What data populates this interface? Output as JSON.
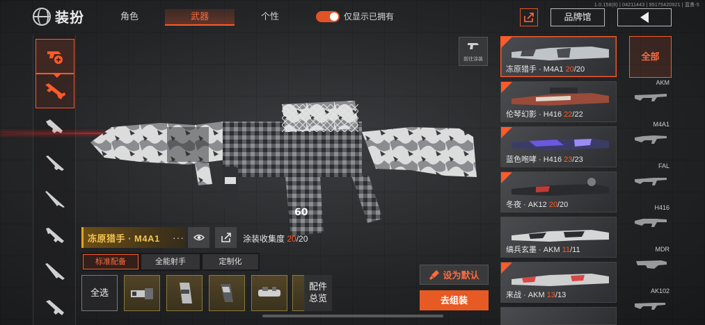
{
  "header": {
    "title": "装扮",
    "tabs": [
      {
        "label": "角色",
        "active": false
      },
      {
        "label": "武器",
        "active": true
      },
      {
        "label": "个性",
        "active": false
      }
    ],
    "toggle_label": "仅显示已拥有",
    "toggle_on": true,
    "version_text": "1.0.158(8) | 04211443 | 95175420921 | 蓝勇-5",
    "brand_button": "品牌馆"
  },
  "left_categories": [
    {
      "icon": "skin-brush-icon",
      "active": true
    },
    {
      "icon": "assault-rifle-icon",
      "active": true
    },
    {
      "icon": "smg-icon",
      "active": false
    },
    {
      "icon": "shotgun-icon",
      "active": false
    },
    {
      "icon": "sniper-icon",
      "active": false
    },
    {
      "icon": "marksman-rifle-icon",
      "active": false
    },
    {
      "icon": "bolt-rifle-icon",
      "active": false
    },
    {
      "icon": "lmg-icon",
      "active": false
    }
  ],
  "preview": {
    "goto_skin_label": "前往涂装",
    "weapon_name": "冻原猎手 · M4A1",
    "collect_label": "涂装收集度",
    "collect_owned": "20",
    "collect_total": "/20"
  },
  "subtabs": [
    {
      "label": "标准配备",
      "active": true
    },
    {
      "label": "全能射手",
      "active": false
    },
    {
      "label": "定制化",
      "active": false
    }
  ],
  "attachments": {
    "select_all": "全选",
    "overview_line1": "配件",
    "overview_line2": "总览",
    "items": [
      "muzzle-attachment-icon",
      "magazine-attachment-icon",
      "grip-attachment-icon",
      "scope-attachment-icon"
    ]
  },
  "actions": {
    "set_default": "设为默认",
    "assemble": "去组装"
  },
  "skins": [
    {
      "name": "冻原猎手 · M4A1",
      "owned": "20",
      "total": "/20",
      "selected": true,
      "color": "#bfc4c8"
    },
    {
      "name": "伦琴幻影 · H416",
      "owned": "22",
      "total": "/22",
      "selected": false,
      "color": "#9a4b3a"
    },
    {
      "name": "蓝色咆哮 · H416",
      "owned": "23",
      "total": "/23",
      "selected": false,
      "color": "#5a4cc8"
    },
    {
      "name": "冬夜 · AK12",
      "owned": "20",
      "total": "/20",
      "selected": false,
      "color": "#c23a34"
    },
    {
      "name": "缟兵玄墨 · AKM",
      "owned": "11",
      "total": "/11",
      "selected": false,
      "color": "#d6d6d6"
    },
    {
      "name": "来战 · AKM",
      "owned": "13",
      "total": "/13",
      "selected": false,
      "color": "#d64848"
    }
  ],
  "weapon_types": {
    "all_label": "全部",
    "items": [
      "AKM",
      "M4A1",
      "FAL",
      "H416",
      "MDR",
      "AK102"
    ]
  },
  "colors": {
    "accent": "#ff5a2a",
    "gold": "#f2c34e"
  }
}
